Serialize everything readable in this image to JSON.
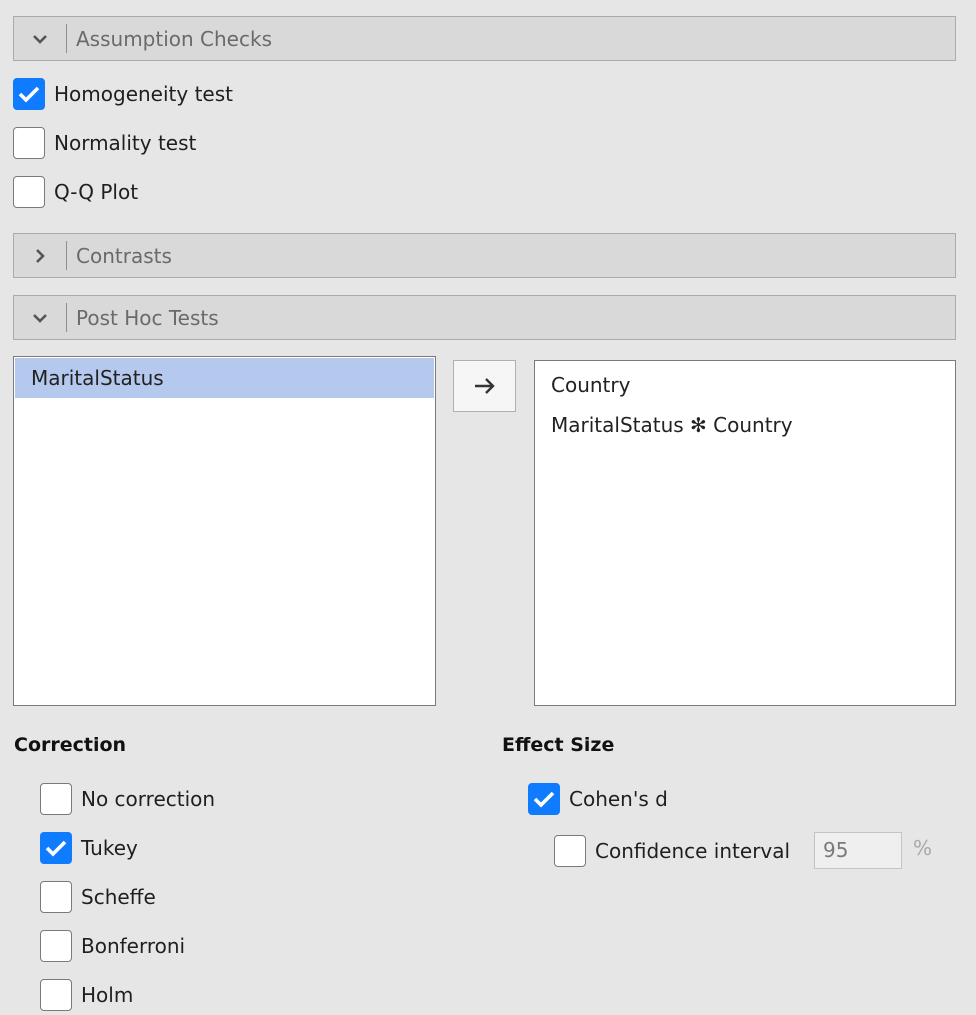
{
  "sections": {
    "assumption_checks": {
      "title": "Assumption Checks",
      "expanded": true,
      "options": [
        {
          "label": "Homogeneity test",
          "checked": true
        },
        {
          "label": "Normality test",
          "checked": false
        },
        {
          "label": "Q-Q Plot",
          "checked": false
        }
      ]
    },
    "contrasts": {
      "title": "Contrasts",
      "expanded": false
    },
    "post_hoc": {
      "title": "Post Hoc Tests",
      "expanded": true,
      "available": [
        "MaritalStatus"
      ],
      "selected_available": "MaritalStatus",
      "move_button_icon": "→",
      "chosen": [
        "Country",
        "MaritalStatus ✻ Country"
      ],
      "correction": {
        "title": "Correction",
        "options": [
          {
            "label": "No correction",
            "checked": false
          },
          {
            "label": "Tukey",
            "checked": true
          },
          {
            "label": "Scheffe",
            "checked": false
          },
          {
            "label": "Bonferroni",
            "checked": false
          },
          {
            "label": "Holm",
            "checked": false
          }
        ]
      },
      "effect_size": {
        "title": "Effect Size",
        "cohens_d": {
          "label": "Cohen's d",
          "checked": true
        },
        "confidence_interval": {
          "label": "Confidence interval",
          "checked": false,
          "value": "95",
          "unit": "%"
        }
      }
    }
  },
  "colors": {
    "accent": "#0f7bff",
    "selection": "#b4c9ed"
  }
}
